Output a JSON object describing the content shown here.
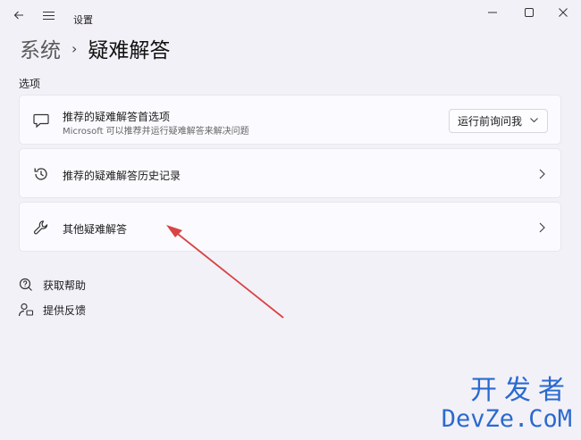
{
  "window": {
    "title": "设置"
  },
  "breadcrumb": {
    "parent": "系统",
    "separator": "›",
    "current": "疑难解答"
  },
  "section": {
    "label": "选项"
  },
  "cards": [
    {
      "title": "推荐的疑难解答首选项",
      "subtitle": "Microsoft 可以推荐并运行疑难解答来解决问题",
      "dropdown_value": "运行前询问我",
      "icon": "message-icon"
    },
    {
      "title": "推荐的疑难解答历史记录",
      "icon": "history-icon"
    },
    {
      "title": "其他疑难解答",
      "icon": "wrench-icon"
    }
  ],
  "links": [
    {
      "label": "获取帮助",
      "icon": "help-icon"
    },
    {
      "label": "提供反馈",
      "icon": "feedback-icon"
    }
  ],
  "watermark": {
    "line1": "开发者",
    "line2": "DevZe.CoM"
  },
  "colors": {
    "background": "#f3f1f8",
    "card": "#fbfaff",
    "arrow": "#d94444",
    "watermark": "#2a6ad0"
  }
}
